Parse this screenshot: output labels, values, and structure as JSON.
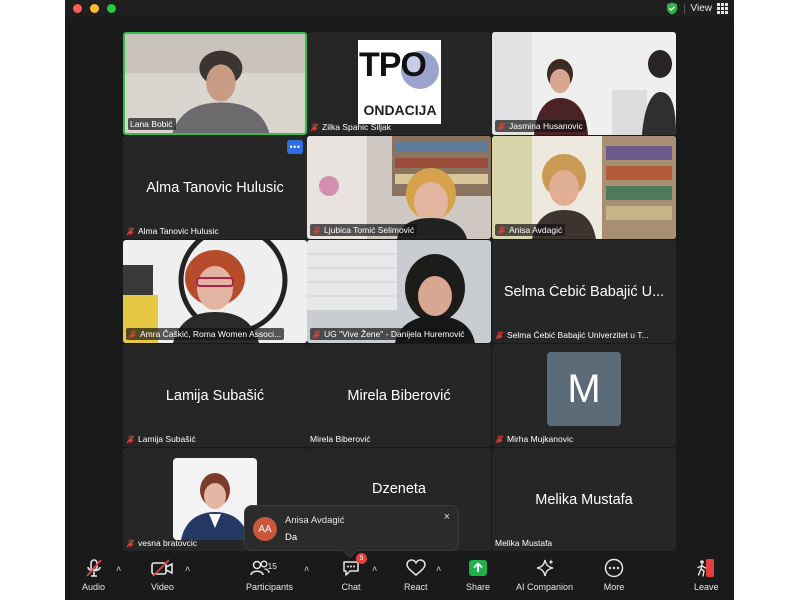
{
  "titlebar": {
    "view_label": "View"
  },
  "tiles": [
    {
      "name": "Lana Bobić",
      "speaking": true
    },
    {
      "name": "Zilka Spahic Siljak",
      "logo_text_top": "TPO",
      "logo_text_bottom": "ONDACIJA"
    },
    {
      "name": "Jasmina Husanovic"
    },
    {
      "name": "Alma Tanovic Hulusic",
      "center": "Alma Tanovic Hulusic",
      "more": "•••"
    },
    {
      "name": "Ljubica Tomić Selimović"
    },
    {
      "name": "Anisa Avdagić"
    },
    {
      "name": "Amra Čaškić, Roma Women Associ..."
    },
    {
      "name": "UG \"Vive Žene\" - Danijela Huremović"
    },
    {
      "name": "Selma Ćebić Babajić Univerzitet u T...",
      "center": "Selma Ćebić Babajić U..."
    },
    {
      "name": "Lamija Subašić",
      "center": "Lamija Subašić"
    },
    {
      "name": "Mirela Biberović",
      "center": "Mirela Biberović"
    },
    {
      "name": "Mirha Mujkanovic",
      "avatar_letter": "M"
    },
    {
      "name": "vesna bratovcic"
    },
    {
      "center": "Dzeneta"
    },
    {
      "name": "Melika Mustafa",
      "center": "Melika Mustafa"
    }
  ],
  "chat_toast": {
    "initials": "AA",
    "sender": "Anisa Avdagić",
    "message": "Da",
    "close": "×"
  },
  "toolbar": {
    "audio": "Audio",
    "video": "Video",
    "participants": "Participants",
    "participants_count": "15",
    "chat": "Chat",
    "chat_badge": "5",
    "react": "React",
    "share": "Share",
    "ai": "AI Companion",
    "more": "More",
    "leave": "Leave"
  },
  "colors": {
    "speaking_border": "#30c04a",
    "share_green": "#21b04b",
    "leave_red": "#e0413c",
    "muted_red": "#e0413c",
    "avatar_m": "#5b6b78"
  }
}
